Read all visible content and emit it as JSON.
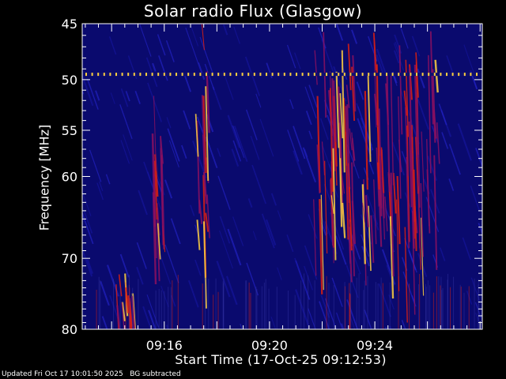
{
  "chart_data": {
    "type": "heatmap",
    "title": "Solar radio Flux (Glasgow)",
    "xlabel": "Start Time (17-Oct-25 09:12:53)",
    "ylabel": "Frequency [MHz]",
    "yticks": [
      45,
      50,
      55,
      60,
      70,
      80
    ],
    "xticks": [
      "09:16",
      "09:20",
      "09:24"
    ],
    "xlim": [
      "09:12:53",
      "09:28:05"
    ],
    "ylim": [
      45,
      80
    ],
    "y_scale": "log",
    "y_inverted": true,
    "colormap": [
      "#0a0a6e",
      "#2828d8",
      "#8a1060",
      "#e02010",
      "#ffd040",
      "#ffffb0"
    ],
    "interference_band_mhz": 49.5
  },
  "footer": "Updated Fri Oct 17 10:01:50 2025   BG subtracted"
}
